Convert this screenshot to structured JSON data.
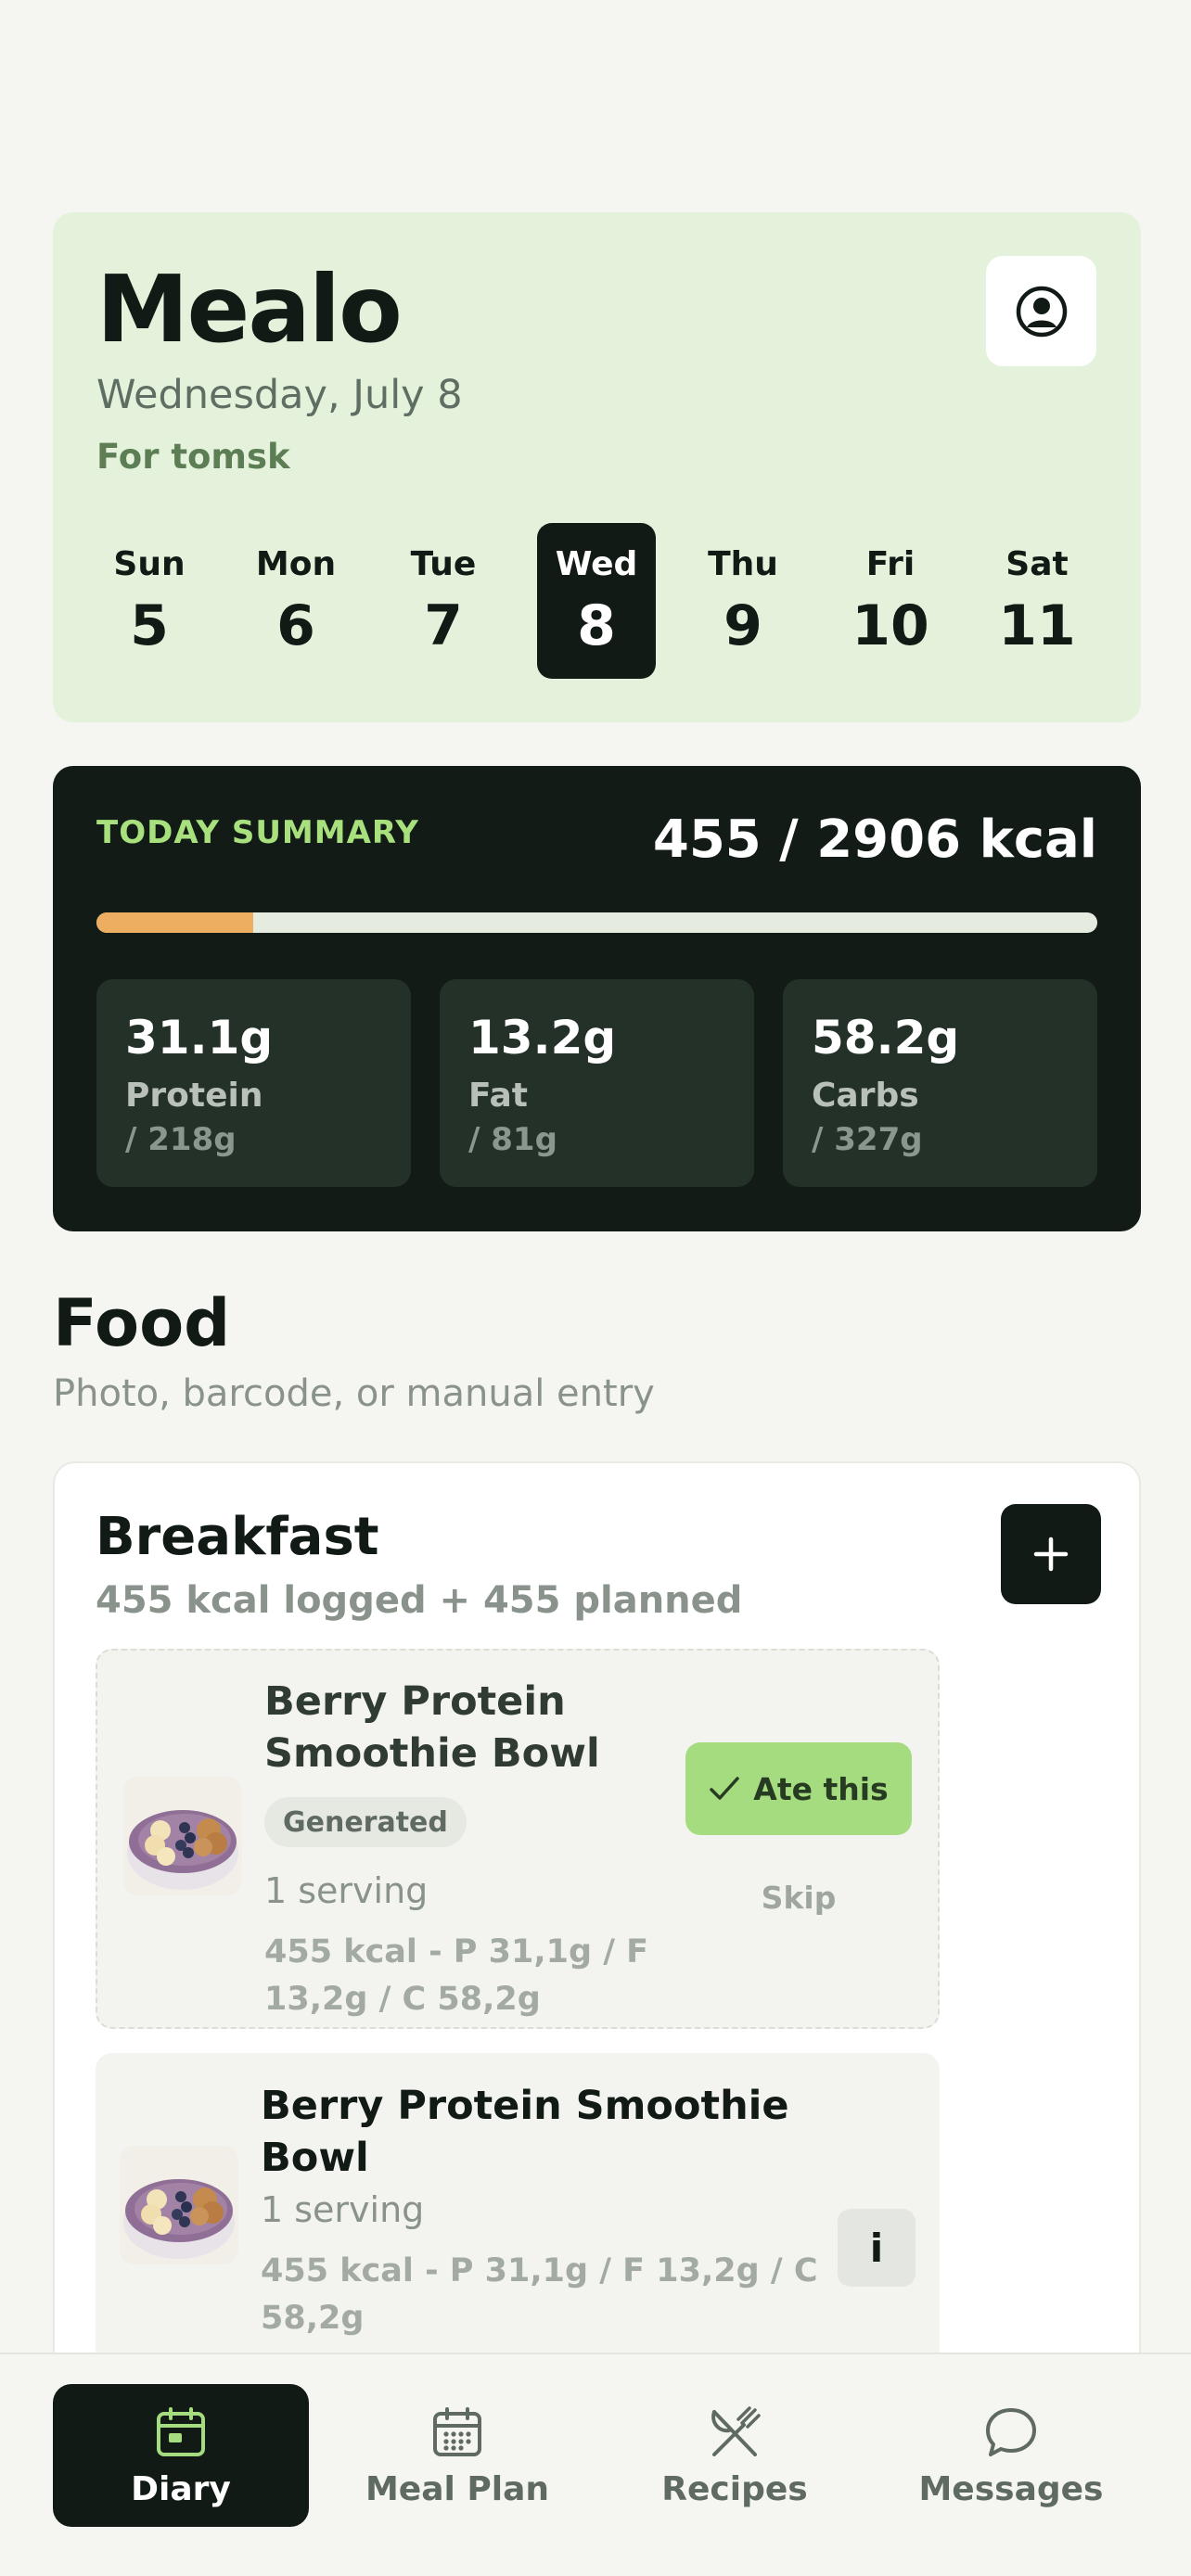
{
  "app": {
    "title": "Mealo",
    "date": "Wednesday, July 8",
    "user_line": "For tomsk"
  },
  "week": [
    {
      "name": "Sun",
      "num": "5"
    },
    {
      "name": "Mon",
      "num": "6"
    },
    {
      "name": "Tue",
      "num": "7"
    },
    {
      "name": "Wed",
      "num": "8",
      "selected": true
    },
    {
      "name": "Thu",
      "num": "9"
    },
    {
      "name": "Fri",
      "num": "10"
    },
    {
      "name": "Sat",
      "num": "11"
    }
  ],
  "summary": {
    "label": "TODAY SUMMARY",
    "kcal": "455 / 2906 kcal",
    "progress_fraction": 0.157,
    "macros": [
      {
        "value": "31.1g",
        "name": "Protein",
        "goal": "/ 218g"
      },
      {
        "value": "13.2g",
        "name": "Fat",
        "goal": "/ 81g"
      },
      {
        "value": "58.2g",
        "name": "Carbs",
        "goal": "/ 327g"
      }
    ]
  },
  "food": {
    "title": "Food",
    "subtitle": "Photo, barcode, or manual entry"
  },
  "breakfast": {
    "title": "Breakfast",
    "subtitle": "455 kcal logged + 455 planned",
    "add_icon": "plus-icon",
    "planned": {
      "title_line1": "Berry Protein",
      "title_line2": "Smoothie Bowl",
      "badge": "Generated",
      "serving": "1 serving",
      "macros_line1": "455 kcal - P 31,1g / F",
      "macros_line2": "13,2g / C 58,2g",
      "ate_label": "Ate this",
      "skip_label": "Skip"
    },
    "logged": {
      "title_line1": "Berry Protein Smoothie",
      "title_line2": "Bowl",
      "serving": "1 serving",
      "macros_line1": "455 kcal - P 31,1g / F 13,2g / C",
      "macros_line2": "58,2g",
      "info_label": "i"
    }
  },
  "nav": [
    {
      "label": "Diary",
      "icon": "calendar-icon",
      "active": true
    },
    {
      "label": "Meal Plan",
      "icon": "calendar-grid-icon"
    },
    {
      "label": "Recipes",
      "icon": "utensils-icon"
    },
    {
      "label": "Messages",
      "icon": "chat-icon"
    }
  ],
  "colors": {
    "accent_green": "#a5dc7f",
    "dark": "#121a15",
    "progress": "#eeae62"
  }
}
